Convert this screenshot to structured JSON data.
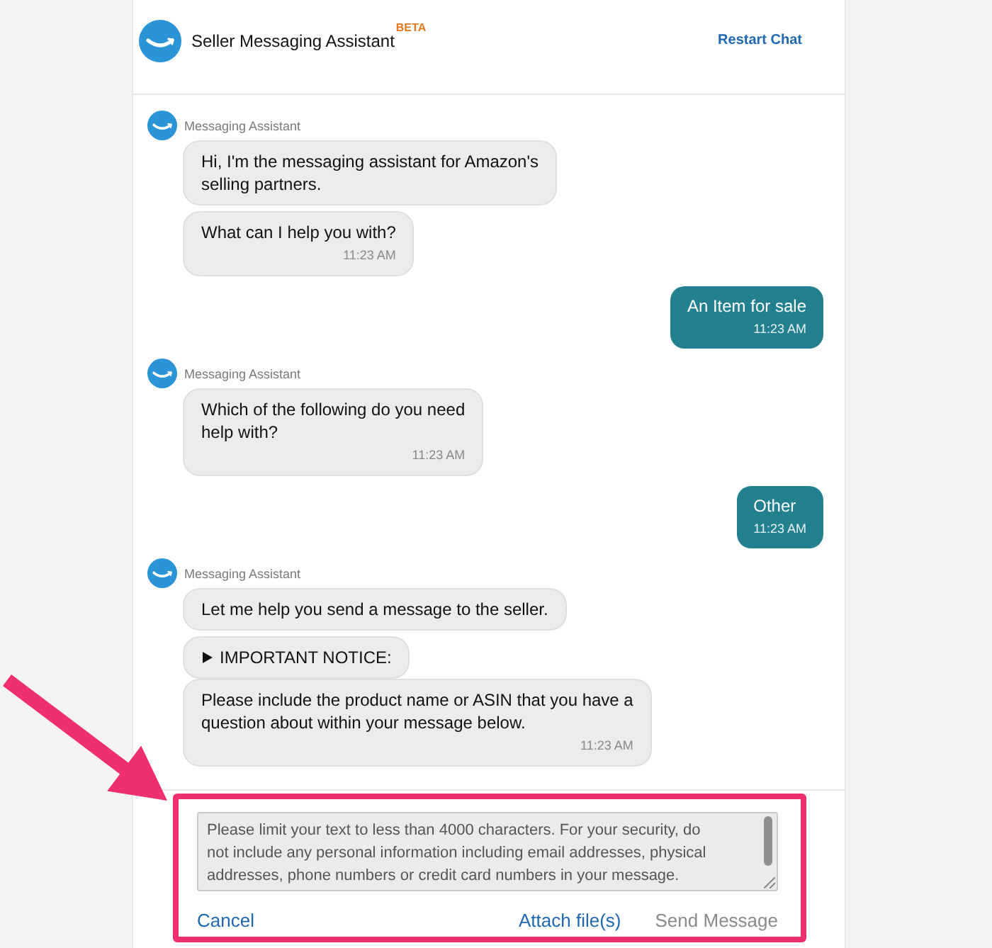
{
  "header": {
    "title": "Seller Messaging Assistant",
    "badge": "BETA",
    "restart_link": "Restart Chat"
  },
  "messages": [
    {
      "kind": "assistant",
      "sender": "Messaging Assistant",
      "bubbles": [
        {
          "kind": "text",
          "text": "Hi, I'm the messaging assistant for Amazon's\nselling partners."
        },
        {
          "kind": "text",
          "text": "What can I help you with?",
          "time": "11:23 AM"
        }
      ]
    },
    {
      "kind": "user",
      "text": "An Item for sale",
      "time": "11:23 AM"
    },
    {
      "kind": "assistant",
      "sender": "Messaging Assistant",
      "bubbles": [
        {
          "kind": "text",
          "text": "Which of the following do you need\nhelp with?",
          "time": "11:23 AM"
        }
      ]
    },
    {
      "kind": "user",
      "text": "Other",
      "time": "11:23 AM"
    },
    {
      "kind": "assistant",
      "sender": "Messaging Assistant",
      "bubbles": [
        {
          "kind": "text",
          "text": "Let me help you send a message to the seller."
        },
        {
          "kind": "disclosure",
          "text": "IMPORTANT NOTICE:",
          "expanded": false
        },
        {
          "kind": "text",
          "text": "Please include the product name or ASIN that you have a\nquestion about within your message below.",
          "time": "11:23 AM"
        }
      ]
    }
  ],
  "composer": {
    "placeholder": "Please limit your text to less than 4000 characters. For your security, do\nnot include any personal information including email addresses, physical\naddresses, phone numbers or credit card numbers in your message.",
    "buttons": [
      {
        "label": "Cancel",
        "disabled": false
      },
      {
        "label": "Attach file(s)",
        "disabled": false
      },
      {
        "label": "Send Message",
        "disabled": true
      }
    ]
  }
}
